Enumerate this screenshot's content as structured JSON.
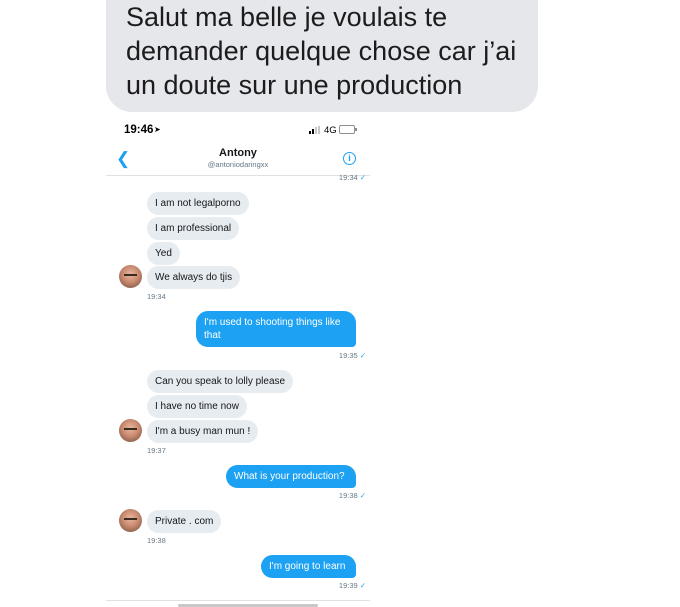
{
  "caption": {
    "lines": [
      "Salut ma belle je voulais te",
      "demander quelque chose car j’ai",
      "un doute sur une production"
    ]
  },
  "status_bar": {
    "time": "19:46",
    "network": "4G"
  },
  "header": {
    "name": "Antony",
    "handle": "@antoniodaringxx"
  },
  "messages": {
    "ts_top": "19:34",
    "in1": "I am not legalporno",
    "in2": "I am professional",
    "in3": "Yed",
    "in4": "We always do tjis",
    "ts_in_a": "19:34",
    "out1_line1": "I'm used to shooting things like",
    "out1_line2": "that",
    "ts_out1": "19:35",
    "in5": "Can you speak to lolly please",
    "in6": "I have no time now",
    "in7": "I'm a busy man mun !",
    "ts_in_b": "19:37",
    "out2": "What is your production?",
    "ts_out2": "19:38",
    "in8": "Private . com",
    "ts_in_c": "19:38",
    "out3": "I'm going to learn",
    "ts_out3": "19:39"
  },
  "colors": {
    "accent": "#1da1f2",
    "incoming_bubble": "#e6ecf0",
    "caption_bubble": "#e6e7eb"
  },
  "icons": [
    "location-arrow-icon",
    "signal-icon",
    "battery-icon",
    "back-chevron-icon",
    "info-icon",
    "read-check-icon"
  ]
}
